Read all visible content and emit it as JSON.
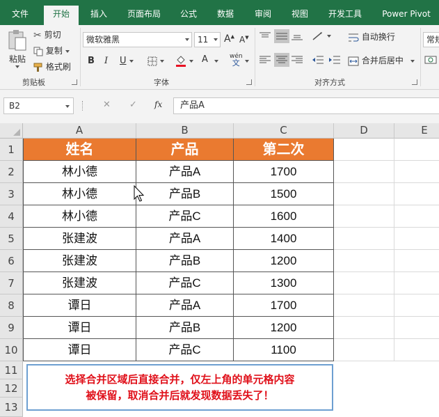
{
  "ribbon": {
    "tabs": [
      "文件",
      "开始",
      "插入",
      "页面布局",
      "公式",
      "数据",
      "审阅",
      "视图",
      "开发工具",
      "Power Pivot"
    ],
    "active_tab": "开始",
    "clipboard": {
      "paste": "粘贴",
      "cut": "剪切",
      "copy": "复制",
      "format_painter": "格式刷",
      "group_label": "剪贴板"
    },
    "font": {
      "font_name": "微软雅黑",
      "font_size": "11",
      "grow": "A",
      "shrink": "A",
      "bold": "B",
      "italic": "I",
      "underline": "U",
      "font_color": "A",
      "phonetic": "wén",
      "phonetic_char": "文",
      "group_label": "字体"
    },
    "alignment": {
      "wrap_text": "自动换行",
      "merge_center": "合并后居中",
      "group_label": "对齐方式"
    },
    "number": {
      "format": "常规"
    }
  },
  "formula_bar": {
    "name_box": "B2",
    "cancel": "✕",
    "enter": "✓",
    "fx": "fx",
    "content": "产品A"
  },
  "sheet": {
    "columns": [
      "A",
      "B",
      "C",
      "D",
      "E"
    ],
    "rows": [
      "1",
      "2",
      "3",
      "4",
      "5",
      "6",
      "7",
      "8",
      "9",
      "10",
      "11",
      "12",
      "13"
    ],
    "header": [
      "姓名",
      "产品",
      "第二次"
    ],
    "data": [
      [
        "林小德",
        "产品A",
        "1700"
      ],
      [
        "林小德",
        "产品B",
        "1500"
      ],
      [
        "林小德",
        "产品C",
        "1600"
      ],
      [
        "张建波",
        "产品A",
        "1400"
      ],
      [
        "张建波",
        "产品B",
        "1200"
      ],
      [
        "张建波",
        "产品C",
        "1300"
      ],
      [
        "谭日",
        "产品A",
        "1700"
      ],
      [
        "谭日",
        "产品B",
        "1200"
      ],
      [
        "谭日",
        "产品C",
        "1100"
      ]
    ],
    "header_color": "#EA7A30",
    "note_line1": "选择合并区域后直接合并，仅左上角的单元格内容",
    "note_line2": "被保留，取消合并后就发现数据丢失了！",
    "note_color": "#E0101A"
  },
  "colors": {
    "ribbon_green": "#217346",
    "ribbon_bg": "#F3F3F3"
  }
}
